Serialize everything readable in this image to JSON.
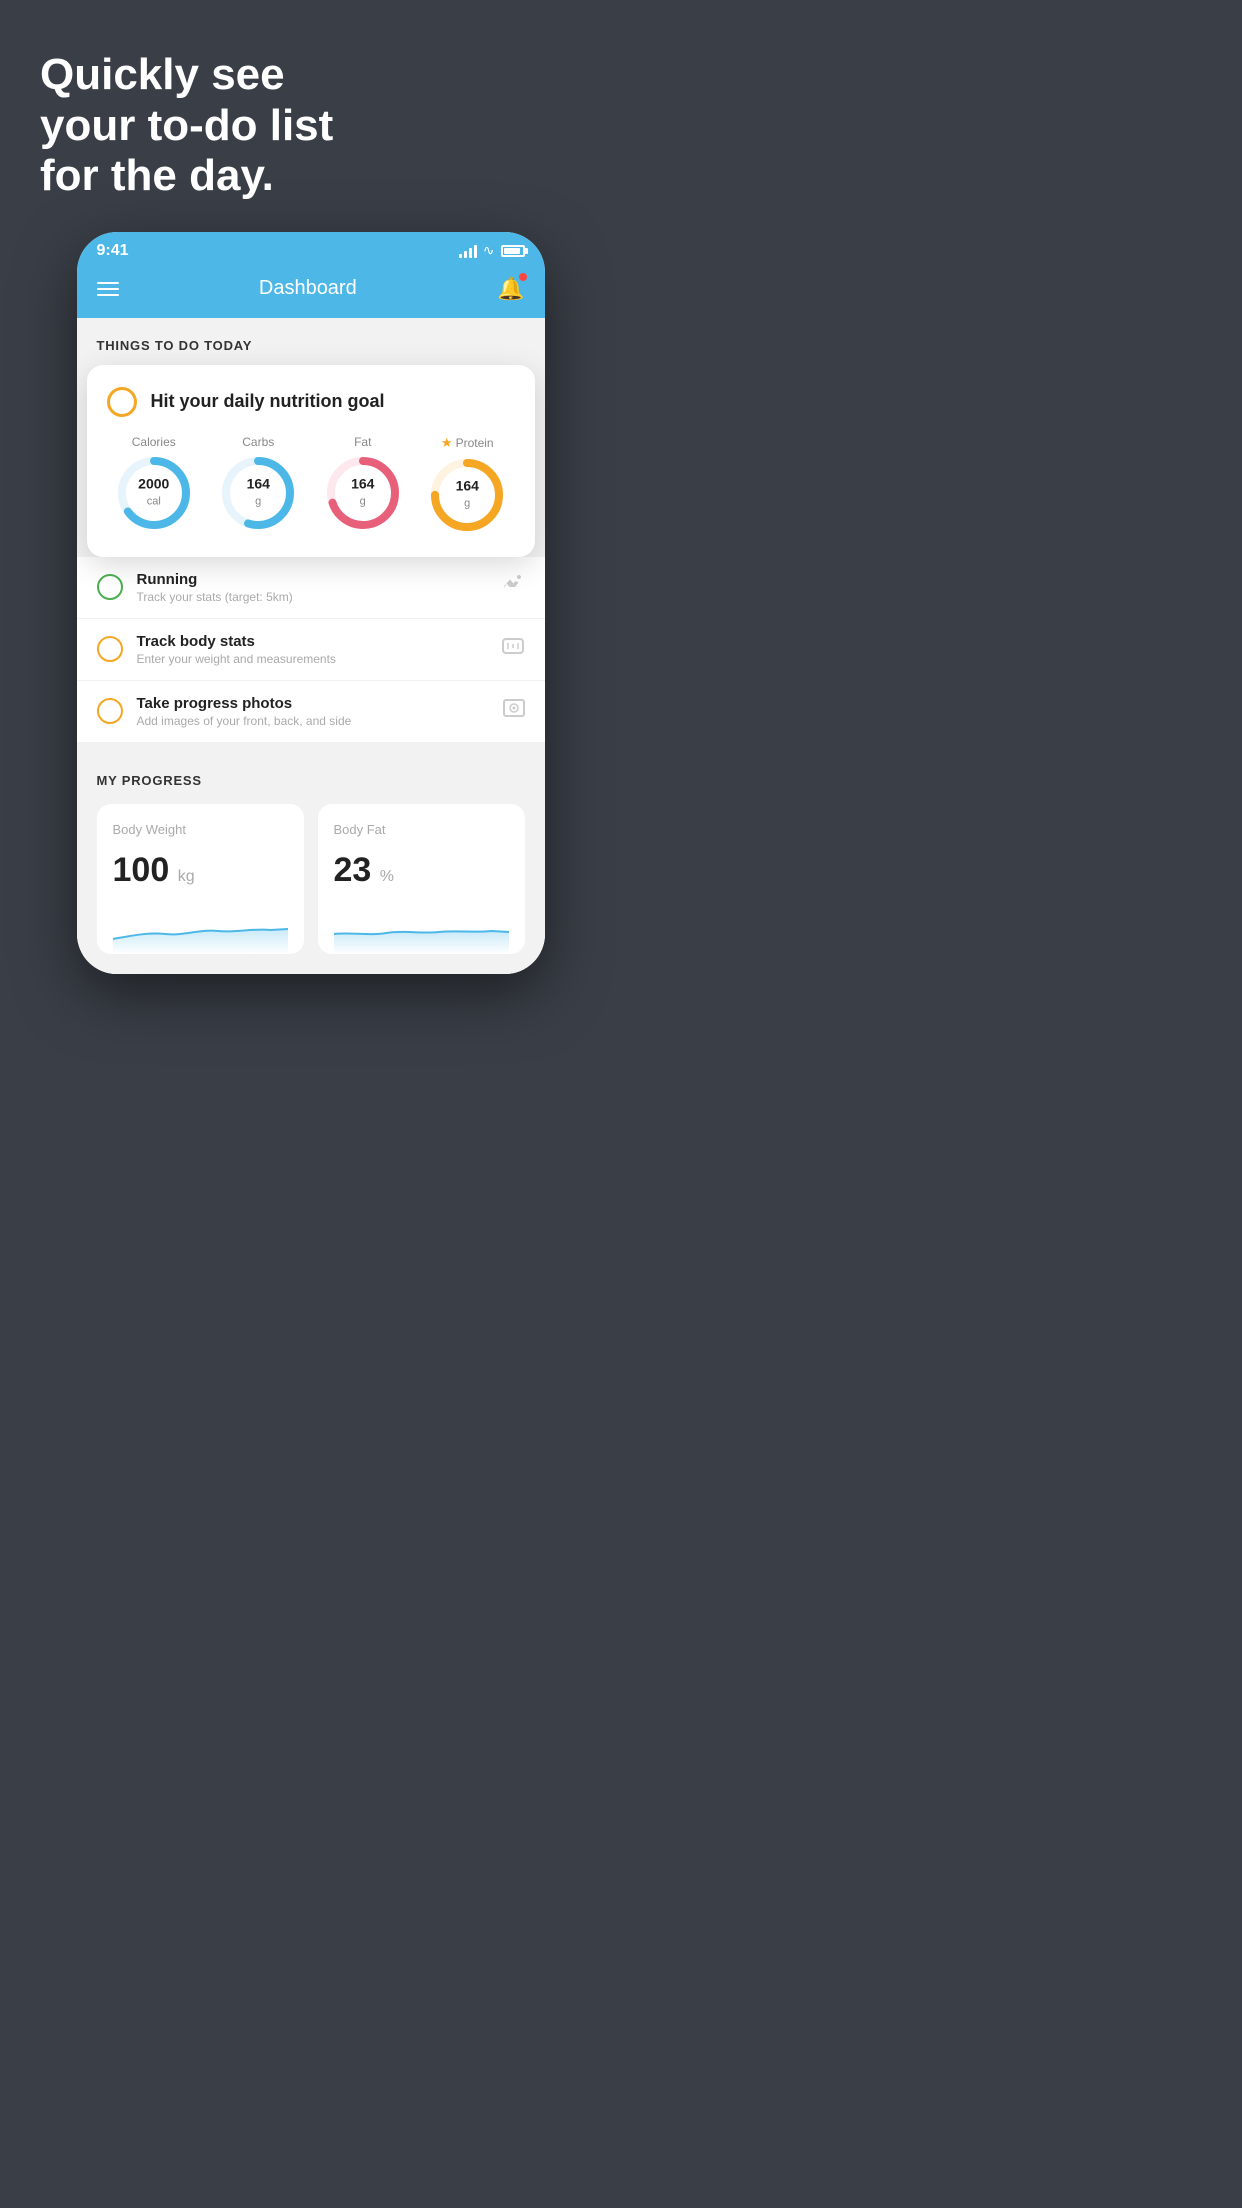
{
  "hero": {
    "title": "Quickly see\nyour to-do list\nfor the day."
  },
  "phone": {
    "statusBar": {
      "time": "9:41"
    },
    "navBar": {
      "title": "Dashboard"
    },
    "content": {
      "sectionTitle": "THINGS TO DO TODAY",
      "featuredCard": {
        "checkLabel": "",
        "title": "Hit your daily nutrition goal",
        "nutrition": [
          {
            "label": "Calories",
            "value": "2000",
            "unit": "cal",
            "color": "#4db8e8",
            "percent": 65
          },
          {
            "label": "Carbs",
            "value": "164",
            "unit": "g",
            "color": "#4db8e8",
            "percent": 55
          },
          {
            "label": "Fat",
            "value": "164",
            "unit": "g",
            "color": "#e85f7a",
            "percent": 70
          },
          {
            "label": "Protein",
            "value": "164",
            "unit": "g",
            "color": "#f5a623",
            "percent": 75,
            "starred": true
          }
        ]
      },
      "todoItems": [
        {
          "id": "running",
          "name": "Running",
          "sub": "Track your stats (target: 5km)",
          "circleColor": "green",
          "icon": "👟"
        },
        {
          "id": "body-stats",
          "name": "Track body stats",
          "sub": "Enter your weight and measurements",
          "circleColor": "yellow",
          "icon": "⚖️"
        },
        {
          "id": "progress-photos",
          "name": "Take progress photos",
          "sub": "Add images of your front, back, and side",
          "circleColor": "yellow",
          "icon": "🖼️"
        }
      ],
      "progressSection": {
        "title": "MY PROGRESS",
        "cards": [
          {
            "id": "body-weight",
            "label": "Body Weight",
            "value": "100",
            "unit": "kg"
          },
          {
            "id": "body-fat",
            "label": "Body Fat",
            "value": "23",
            "unit": "%"
          }
        ]
      }
    }
  }
}
